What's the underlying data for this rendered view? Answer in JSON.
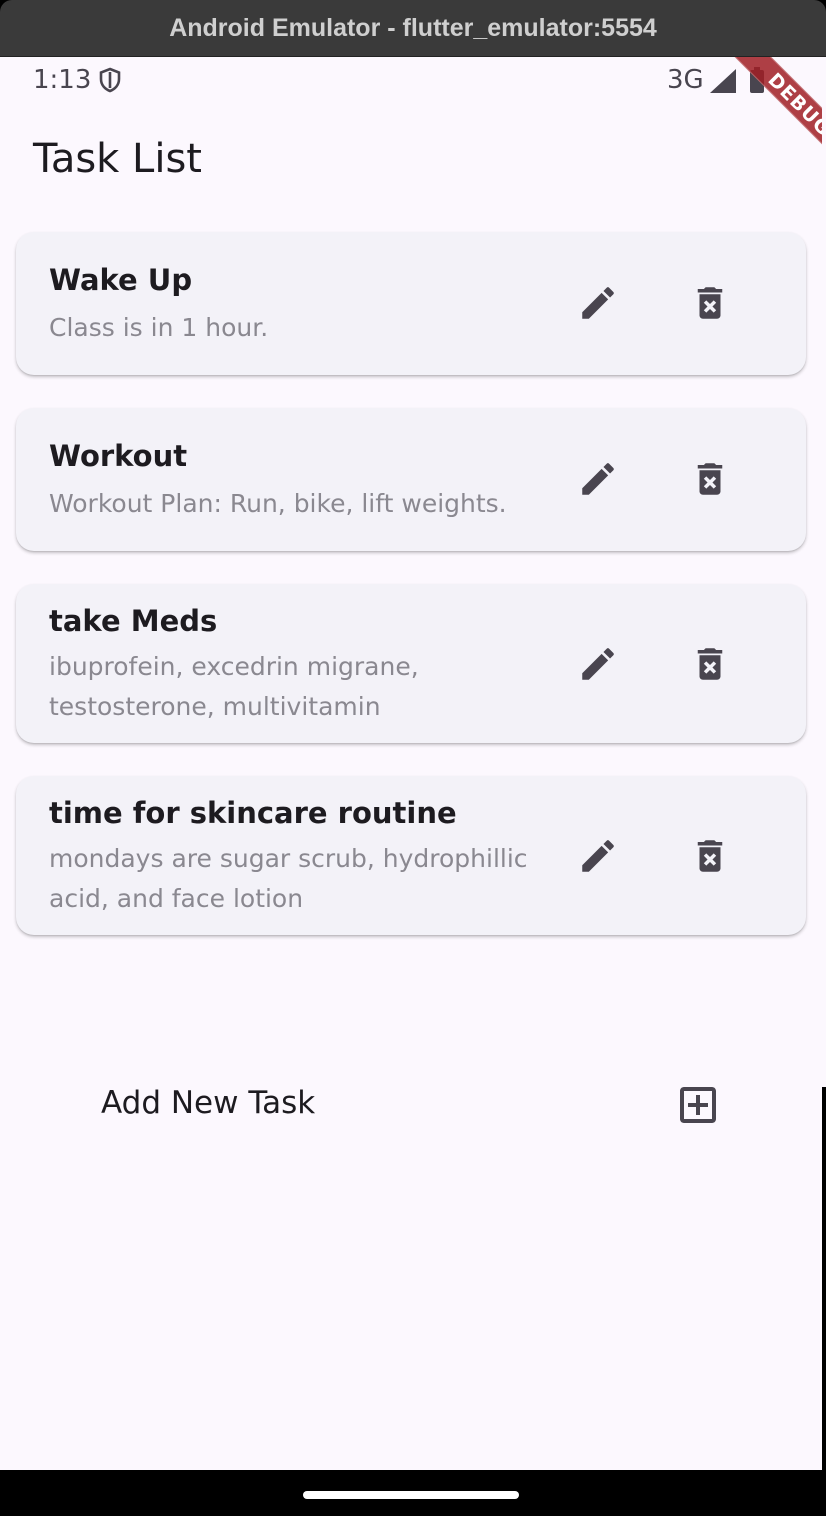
{
  "window": {
    "title": "Android Emulator - flutter_emulator:5554"
  },
  "status_bar": {
    "time": "1:13",
    "network": "3G"
  },
  "debug_banner": {
    "label": "DEBUG"
  },
  "app": {
    "title": "Task List"
  },
  "tasks": [
    {
      "title": "Wake Up",
      "description": "Class is in 1 hour."
    },
    {
      "title": "Workout",
      "description": "Workout Plan: Run, bike, lift weights."
    },
    {
      "title": "take Meds",
      "description": "ibuprofein, excedrin migrane, testosterone, multivitamin"
    },
    {
      "title": "time for skincare routine",
      "description": "mondays are sugar scrub, hydrophillic acid, and face lotion"
    }
  ],
  "add_task": {
    "label": "Add New Task"
  },
  "icons": {
    "edit": "pencil-icon",
    "delete": "delete-forever-icon",
    "add": "add-box-icon"
  },
  "colors": {
    "background": "#fcf8fe",
    "card": "#f3f2f8",
    "icon": "#49454f",
    "debug": "#a01e24"
  }
}
